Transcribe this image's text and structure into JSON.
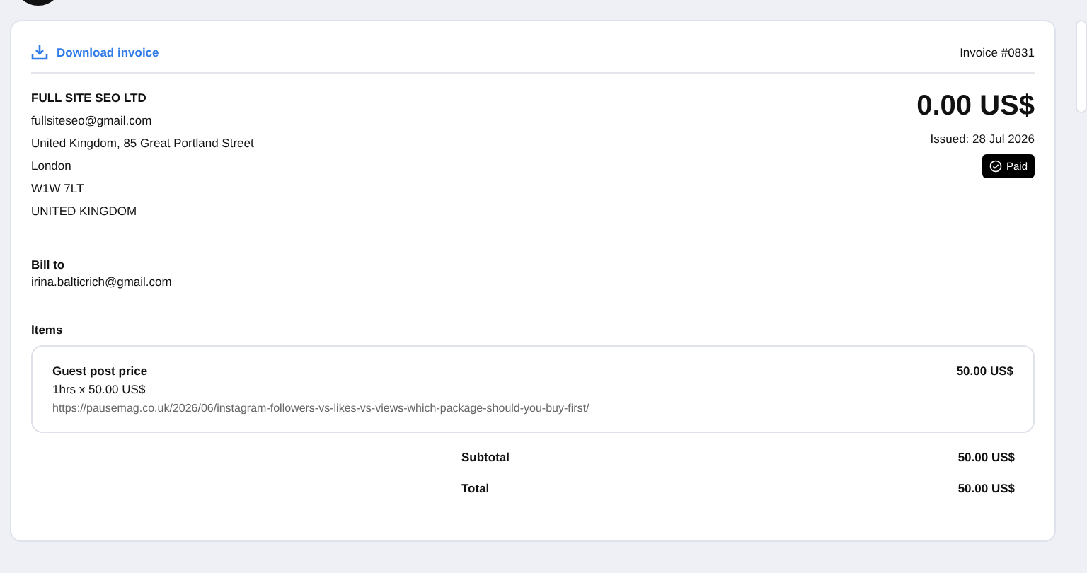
{
  "download_link": "Download invoice",
  "invoice_number": "Invoice #0831",
  "seller": {
    "name": "FULL SITE SEO LTD",
    "lines": [
      "fullsiteseo@gmail.com",
      "United Kingdom, 85 Great Portland Street",
      "London",
      "W1W 7LT",
      "UNITED KINGDOM"
    ]
  },
  "amount": "0.00 US$",
  "issued": "Issued: 28 Jul 2026",
  "status": "Paid",
  "bill_to": {
    "heading": "Bill to",
    "email": "irina.balticrich@gmail.com"
  },
  "items_heading": "Items",
  "items": [
    {
      "title": "Guest post price",
      "quantity": "1hrs x 50.00 US$",
      "url": "https://pausemag.co.uk/2026/06/instagram-followers-vs-likes-vs-views-which-package-should-you-buy-first/",
      "price": "50.00 US$"
    }
  ],
  "totals": [
    {
      "label": "Subtotal",
      "value": "50.00 US$"
    },
    {
      "label": "Total",
      "value": "50.00 US$"
    }
  ]
}
